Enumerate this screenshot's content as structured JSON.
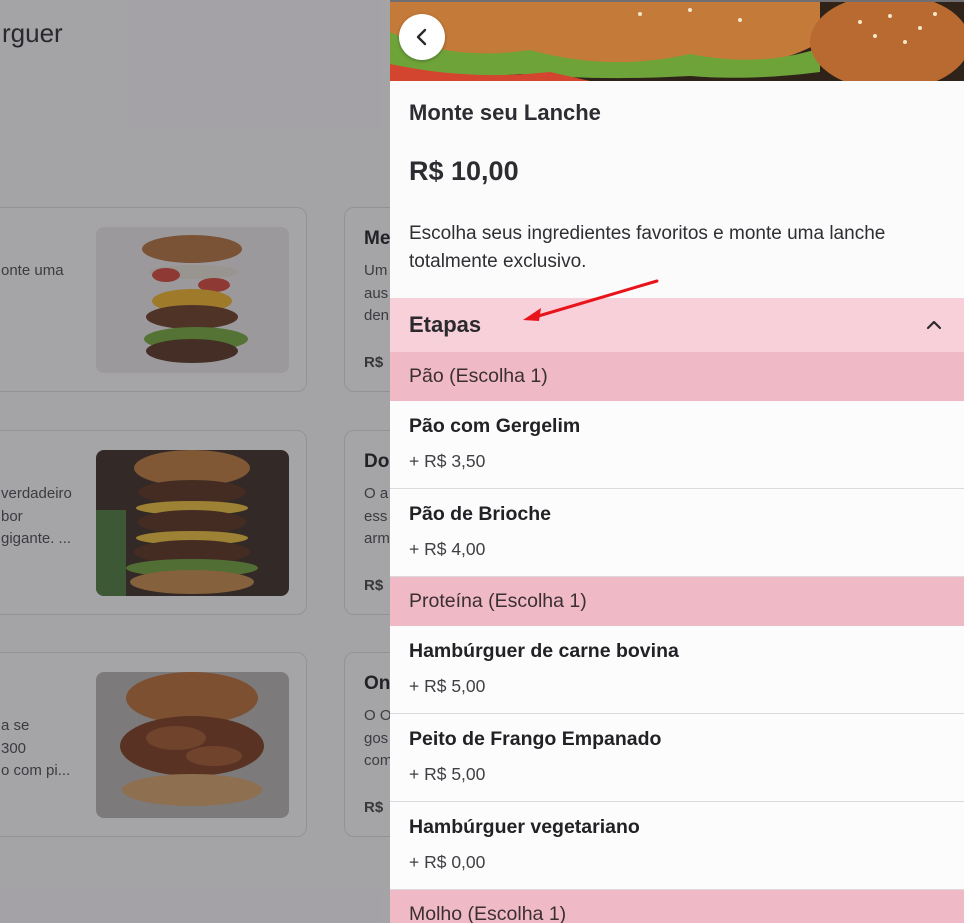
{
  "background_page": {
    "title_fragment": "rguer",
    "cards": [
      {
        "desc_lines": [
          "onte uma"
        ],
        "price_fragment": ""
      },
      {
        "name_fragment": "Me",
        "desc_lines": [
          "Um",
          "aus",
          "den"
        ],
        "price_fragment": "R$"
      },
      {
        "desc_lines": [
          "verdadeiro",
          "bor",
          "gigante. ..."
        ],
        "price_fragment": ""
      },
      {
        "name_fragment": "Do",
        "desc_lines": [
          "O a",
          "ess",
          "arm"
        ],
        "price_fragment": "R$"
      },
      {
        "desc_lines": [
          "a se",
          "300",
          "o com pi..."
        ],
        "price_fragment": ""
      },
      {
        "name_fragment": "On",
        "desc_lines": [
          "O O",
          "gos",
          "com"
        ],
        "price_fragment": "R$"
      }
    ]
  },
  "drawer": {
    "title": "Monte seu Lanche",
    "price": "R$ 10,00",
    "description": "Escolha seus ingredientes favoritos e monte uma lanche totalmente exclusivo.",
    "steps_label": "Etapas",
    "groups": [
      {
        "label": "Pão (Escolha 1)",
        "options": [
          {
            "name": "Pão com Gergelim",
            "price": "+ R$ 3,50"
          },
          {
            "name": "Pão de Brioche",
            "price": "+ R$ 4,00"
          }
        ]
      },
      {
        "label": "Proteína (Escolha 1)",
        "options": [
          {
            "name": "Hambúrguer de carne bovina",
            "price": "+ R$ 5,00"
          },
          {
            "name": "Peito de Frango Empanado",
            "price": "+ R$ 5,00"
          },
          {
            "name": "Hambúrguer vegetariano",
            "price": "+ R$ 0,00"
          }
        ]
      },
      {
        "label": "Molho (Escolha 1)",
        "options": []
      }
    ]
  },
  "icons": {
    "back": "chevron-left-icon",
    "collapse": "chevron-up-icon"
  },
  "colors": {
    "steps_header": "#f7d0da",
    "group_header": "#f0b9c6",
    "annotation_arrow": "#e8141b"
  }
}
